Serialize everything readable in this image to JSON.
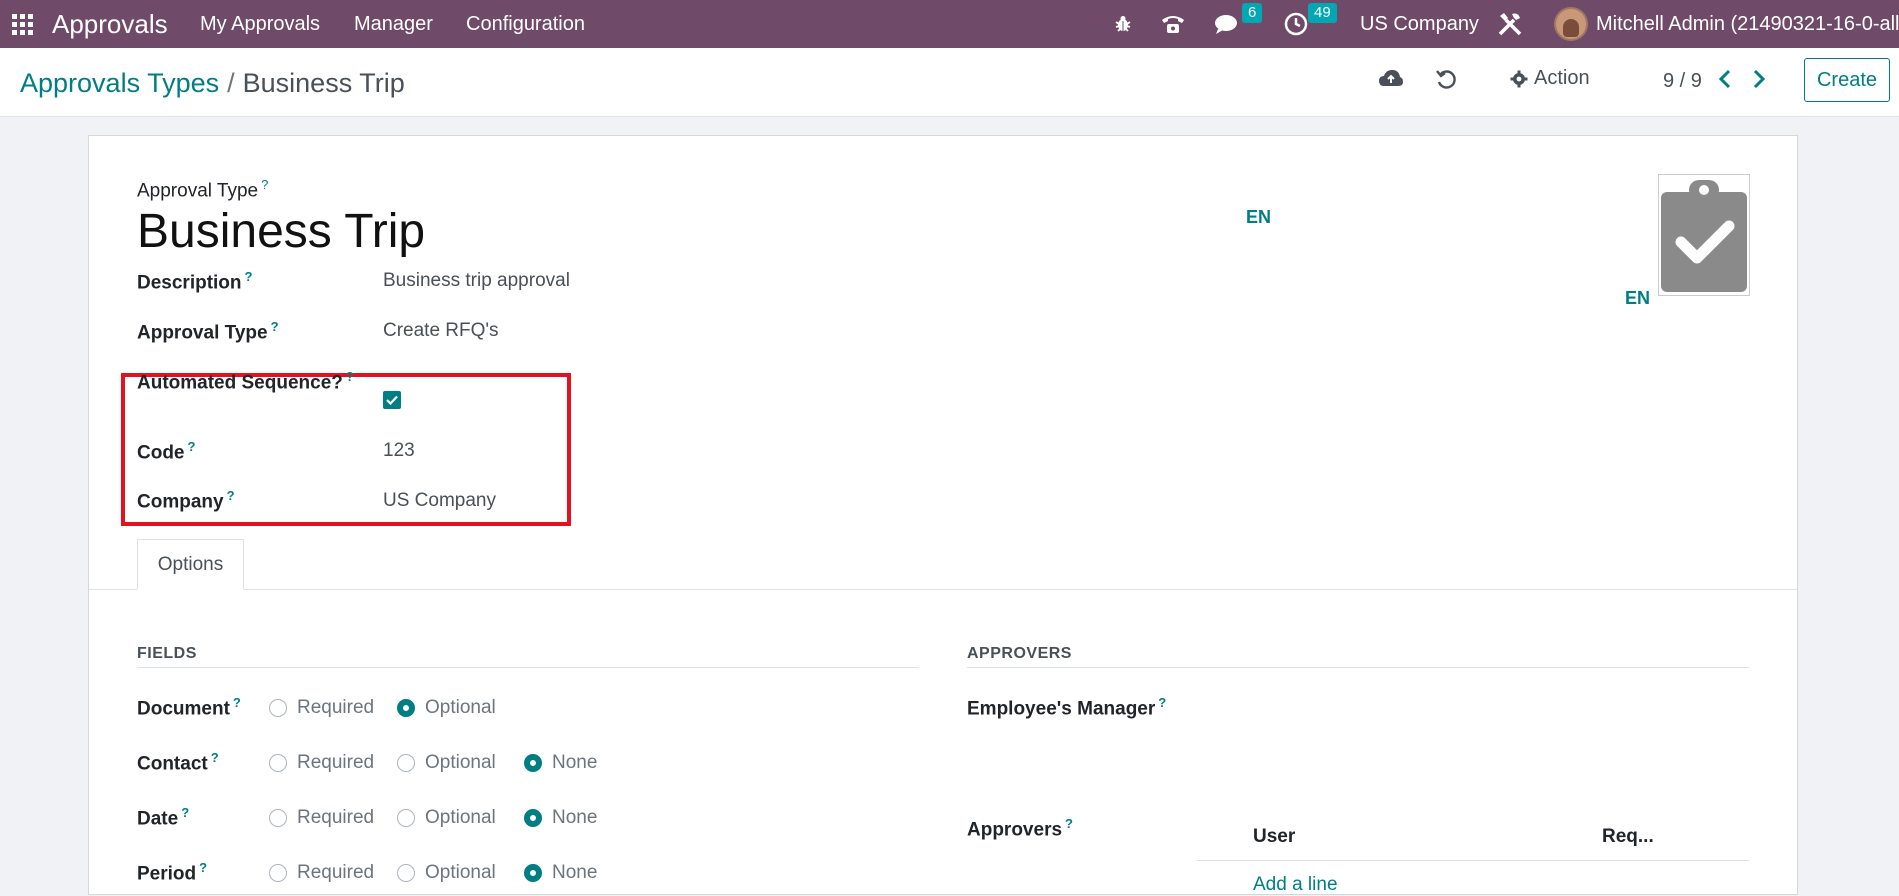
{
  "navbar": {
    "app_name": "Approvals",
    "menu": [
      "My Approvals",
      "Manager",
      "Configuration"
    ],
    "messages_count": "6",
    "activities_count": "49",
    "company": "US Company",
    "user": "Mitchell Admin (21490321-16-0-all)"
  },
  "control_panel": {
    "breadcrumb_parent": "Approvals Types",
    "breadcrumb_separator": "/",
    "breadcrumb_current": "Business Trip",
    "action_label": "Action",
    "pager": "9 / 9",
    "create_label": "Create"
  },
  "form": {
    "name_label": "Approval Type",
    "title": "Business Trip",
    "lang_title": "EN",
    "lang_description": "EN",
    "fields": {
      "description": {
        "label": "Description",
        "value": "Business trip approval"
      },
      "approval_type": {
        "label": "Approval Type",
        "value": "Create RFQ's"
      },
      "automated_sequence": {
        "label": "Automated Sequence?",
        "checked": true
      },
      "code": {
        "label": "Code",
        "value": "123"
      },
      "company": {
        "label": "Company",
        "value": "US Company"
      }
    },
    "tabs": [
      "Options"
    ],
    "fields_section": {
      "title": "FIELDS",
      "rows": [
        {
          "label": "Document",
          "options": [
            "Required",
            "Optional"
          ],
          "selected": "Optional"
        },
        {
          "label": "Contact",
          "options": [
            "Required",
            "Optional",
            "None"
          ],
          "selected": "None"
        },
        {
          "label": "Date",
          "options": [
            "Required",
            "Optional",
            "None"
          ],
          "selected": "None"
        },
        {
          "label": "Period",
          "options": [
            "Required",
            "Optional",
            "None"
          ],
          "selected": "None"
        }
      ]
    },
    "approvers_section": {
      "title": "APPROVERS",
      "employee_manager_label": "Employee's Manager",
      "approvers_label": "Approvers",
      "columns": [
        "User",
        "Req..."
      ],
      "add_line": "Add a line"
    }
  },
  "colors": {
    "navbar": "#6f4b69",
    "accent": "#017e84",
    "highlight": "#e3121f"
  }
}
